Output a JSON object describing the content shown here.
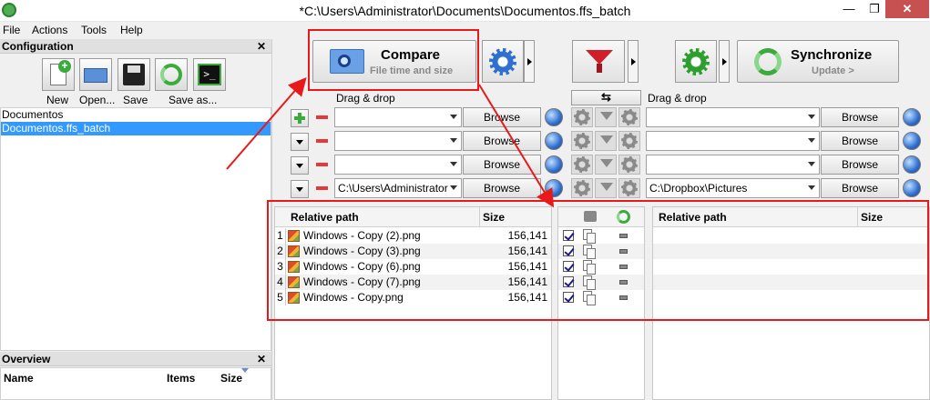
{
  "window": {
    "title": "*C:\\Users\\Administrator\\Documents\\Documentos.ffs_batch",
    "min": "—",
    "max": "❐",
    "close": "✕"
  },
  "menu": [
    "File",
    "Actions",
    "Tools",
    "Help"
  ],
  "config": {
    "header": "Configuration",
    "close": "✕",
    "toolbar": [
      "New",
      "Open...",
      "Save",
      "Save as..."
    ],
    "items": [
      "Documentos",
      "Documentos.ffs_batch"
    ],
    "selected_index": 1
  },
  "overview": {
    "header": "Overview",
    "close": "✕",
    "columns": [
      "Name",
      "Items",
      "Size"
    ]
  },
  "compare": {
    "title": "Compare",
    "subtitle": "File time and size"
  },
  "synchronize": {
    "title": "Synchronize",
    "subtitle": "Update >"
  },
  "dragdrop_left": "Drag & drop",
  "dragdrop_right": "Drag & drop",
  "swap": "⇆",
  "folder_pairs": [
    {
      "left": "",
      "right": "",
      "browse": "Browse"
    },
    {
      "left": "",
      "right": "",
      "browse": "Browse"
    },
    {
      "left": "",
      "right": "",
      "browse": "Browse"
    },
    {
      "left": "C:\\Users\\Administrator",
      "right": "C:\\Dropbox\\Pictures",
      "browse": "Browse"
    }
  ],
  "grid_left": {
    "columns": [
      "Relative path",
      "Size"
    ],
    "rows": [
      {
        "num": "1",
        "name": "Windows - Copy (2).png",
        "size": "156,141"
      },
      {
        "num": "2",
        "name": "Windows - Copy (3).png",
        "size": "156,141"
      },
      {
        "num": "3",
        "name": "Windows - Copy (6).png",
        "size": "156,141"
      },
      {
        "num": "4",
        "name": "Windows - Copy (7).png",
        "size": "156,141"
      },
      {
        "num": "5",
        "name": "Windows - Copy.png",
        "size": "156,141"
      }
    ]
  },
  "grid_right": {
    "columns": [
      "Relative path",
      "Size"
    ]
  },
  "colors": {
    "accent_red": "#e8191b",
    "selection": "#3399ff",
    "close_btn": "#c75050"
  }
}
